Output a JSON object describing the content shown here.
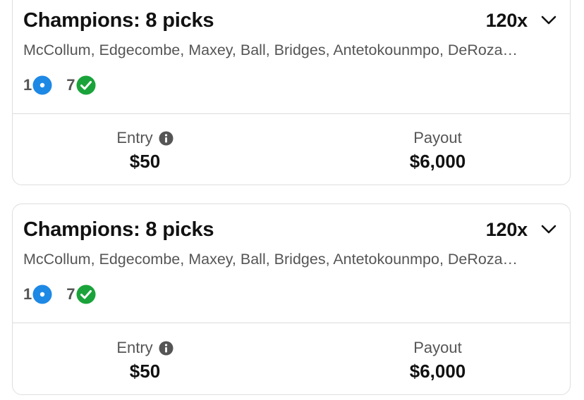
{
  "cards": [
    {
      "title": "Champions: 8 picks",
      "multiplier": "120x",
      "players": "McCollum, Edgecombe, Maxey, Ball, Bridges, Antetokounmpo, DeRoza…",
      "pending_count": "1",
      "won_count": "7",
      "entry_label": "Entry",
      "entry_value": "$50",
      "payout_label": "Payout",
      "payout_value": "$6,000"
    },
    {
      "title": "Champions: 8 picks",
      "multiplier": "120x",
      "players": "McCollum, Edgecombe, Maxey, Ball, Bridges, Antetokounmpo, DeRoza…",
      "pending_count": "1",
      "won_count": "7",
      "entry_label": "Entry",
      "entry_value": "$50",
      "payout_label": "Payout",
      "payout_value": "$6,000"
    }
  ],
  "colors": {
    "pending": "#1e88e5",
    "won": "#1aa33a",
    "info": "#555555"
  },
  "icons": {
    "expand": "chevron-down-icon",
    "pending": "pending-dot-icon",
    "won": "check-circle-icon",
    "info": "info-icon"
  }
}
